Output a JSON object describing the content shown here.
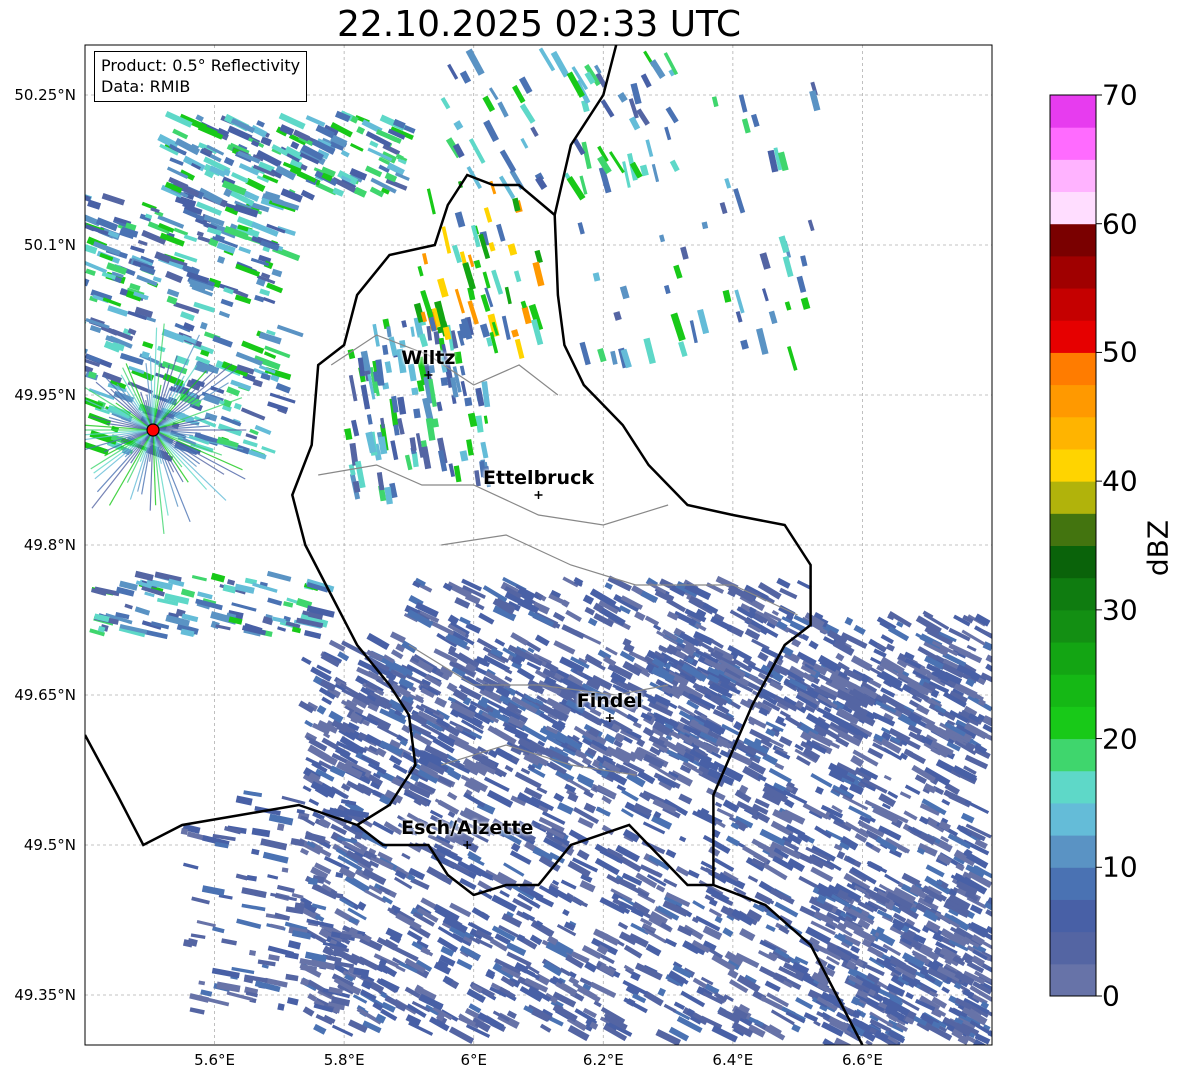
{
  "title": "22.10.2025 02:33 UTC",
  "info_box": {
    "product": "Product: 0.5° Reflectivity",
    "data_source": "Data: RMIB"
  },
  "map": {
    "lon_range": [
      5.4,
      6.8
    ],
    "lat_range": [
      49.3,
      50.3
    ],
    "x_ticks": [
      "5.6°E",
      "5.8°E",
      "6°E",
      "6.2°E",
      "6.4°E",
      "6.6°E"
    ],
    "x_tick_values": [
      5.6,
      5.8,
      6.0,
      6.2,
      6.4,
      6.6
    ],
    "y_ticks": [
      "50.25°N",
      "50.1°N",
      "49.95°N",
      "49.8°N",
      "49.65°N",
      "49.5°N",
      "49.35°N"
    ],
    "y_tick_values": [
      50.25,
      50.1,
      49.95,
      49.8,
      49.65,
      49.5,
      49.35
    ],
    "gridlines": true,
    "cities": [
      {
        "name": "Wiltz",
        "lon": 5.93,
        "lat": 49.97
      },
      {
        "name": "Ettelbruck",
        "lon": 6.1,
        "lat": 49.85
      },
      {
        "name": "Findel",
        "lon": 6.21,
        "lat": 49.627
      },
      {
        "name": "Esch/Alzette",
        "lon": 5.99,
        "lat": 49.5
      }
    ],
    "radar_site": {
      "lon": 5.505,
      "lat": 49.915,
      "color": "#ff0000"
    }
  },
  "colorbar": {
    "label": "dBZ",
    "min": 0,
    "max": 70,
    "tick_labels": [
      "70",
      "60",
      "50",
      "40",
      "30",
      "20",
      "10",
      "0"
    ],
    "tick_values": [
      70,
      60,
      50,
      40,
      30,
      20,
      10,
      0
    ],
    "colors": [
      "#6773a8",
      "#5465a3",
      "#4860a6",
      "#4a72b3",
      "#5a93c4",
      "#64bcd8",
      "#5ed8c8",
      "#3fd66d",
      "#18c918",
      "#15b815",
      "#13a513",
      "#138f13",
      "#0f7c10",
      "#0a630a",
      "#43740f",
      "#b1b30b",
      "#ffd400",
      "#ffb400",
      "#ff9900",
      "#ff7c00",
      "#e60000",
      "#c50000",
      "#a00000",
      "#7a0000",
      "#ffddff",
      "#ffb3ff",
      "#ff6bff",
      "#e73cef"
    ]
  }
}
